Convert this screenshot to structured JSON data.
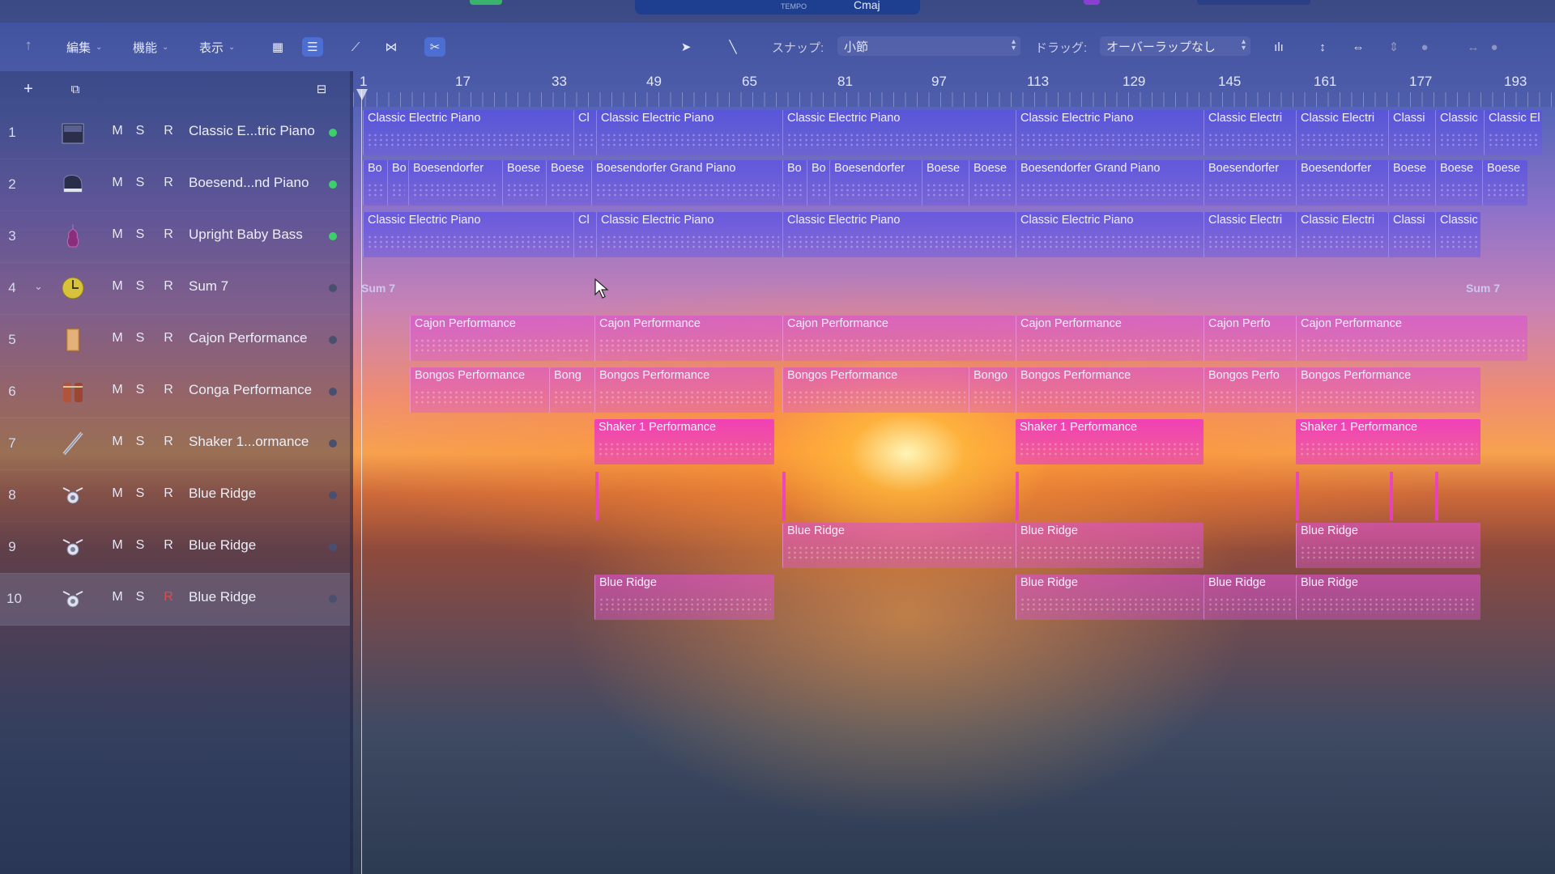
{
  "top": {
    "key_label": "Cmaj",
    "tempo_label": "TEMPO"
  },
  "toolbar": {
    "menus": [
      "編集",
      "機能",
      "表示"
    ],
    "snap_label": "スナップ:",
    "snap_value": "小節",
    "drag_label": "ドラッグ:",
    "drag_value": "オーバーラップなし"
  },
  "ruler": {
    "bars": [
      "1",
      "17",
      "33",
      "49",
      "65",
      "81",
      "97",
      "113",
      "129",
      "145",
      "161",
      "177",
      "193"
    ]
  },
  "tracks": [
    {
      "number": "1",
      "name": "Classic E...tric Piano",
      "m": "M",
      "s": "S",
      "r": "R",
      "icon": "electric-piano-icon"
    },
    {
      "number": "2",
      "name": "Boesend...nd Piano",
      "m": "M",
      "s": "S",
      "r": "R",
      "icon": "grand-piano-icon"
    },
    {
      "number": "3",
      "name": "Upright Baby Bass",
      "m": "M",
      "s": "S",
      "r": "R",
      "icon": "upright-bass-icon"
    },
    {
      "number": "4",
      "name": "Sum 7",
      "m": "M",
      "s": "S",
      "r": "R",
      "icon": "drummer-icon"
    },
    {
      "number": "5",
      "name": "Cajon Performance",
      "m": "M",
      "s": "S",
      "r": "R",
      "icon": "cajon-icon"
    },
    {
      "number": "6",
      "name": "Conga Performance",
      "m": "M",
      "s": "S",
      "r": "R",
      "icon": "conga-icon"
    },
    {
      "number": "7",
      "name": "Shaker 1...ormance",
      "m": "M",
      "s": "S",
      "r": "R",
      "icon": "shaker-icon"
    },
    {
      "number": "8",
      "name": "Blue Ridge",
      "m": "M",
      "s": "S",
      "r": "R",
      "icon": "drum-kit-icon"
    },
    {
      "number": "9",
      "name": "Blue Ridge",
      "m": "M",
      "s": "S",
      "r": "R",
      "icon": "drum-kit-icon"
    },
    {
      "number": "10",
      "name": "Blue Ridge",
      "m": "M",
      "s": "S",
      "r": "R",
      "icon": "drum-kit-icon"
    }
  ],
  "regions": {
    "track1": [
      "Classic Electric Piano",
      "Cl",
      "Classic Electric Piano",
      "Classic Electric Piano",
      "Classic Electric Piano",
      "Classic Electri",
      "Classic Electri",
      "Classi",
      "Classic",
      "Classic El"
    ],
    "track2": [
      "Bo",
      "Bo",
      "Boesendorfer",
      "Boese",
      "Boese",
      "Boesendorfer Grand Piano",
      "Bo",
      "Bo",
      "Boesendorfer",
      "Boese",
      "Boese",
      "Boesendorfer Grand Piano",
      "Boesendorfer",
      "Boesendorfer",
      "Boese",
      "Boese",
      "Boese"
    ],
    "track3": [
      "Classic Electric Piano",
      "Cl",
      "Classic Electric Piano",
      "Classic Electric Piano",
      "Classic Electric Piano",
      "Classic Electri",
      "Classic Electri",
      "Classi",
      "Classic"
    ],
    "track4": [
      "Sum 7",
      "Sum 7"
    ],
    "track5": [
      "Cajon Performance",
      "Cajon Performance",
      "Cajon Performance",
      "Cajon Performance",
      "Cajon Perfo",
      "Cajon Performance"
    ],
    "track6": [
      "Bongos Performance",
      "Bong",
      "Bongos Performance",
      "Bongos Performance",
      "Bongo",
      "Bongos Performance",
      "Bongos Perfo",
      "Bongos Performance"
    ],
    "track7": [
      "Shaker 1 Performance",
      "Shaker 1 Performance",
      "Shaker 1 Performance"
    ],
    "track9": [
      "Blue Ridge",
      "Blue Ridge",
      "Blue Ridge"
    ],
    "track10": [
      "Blue Ridge",
      "Blue Ridge",
      "Blue Ridge",
      "Blue Ridge"
    ]
  },
  "colors": {
    "region_blue": "#5a50e6",
    "region_pink": "#dc50d2",
    "led_green": "#3ecf6b",
    "active_tool": "#5078e6"
  }
}
